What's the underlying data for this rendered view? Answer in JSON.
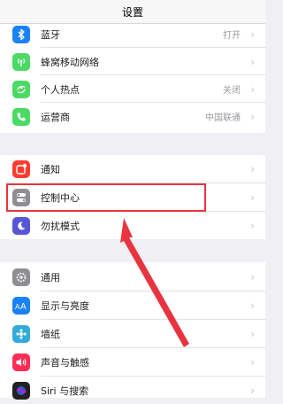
{
  "header": {
    "title": "设置"
  },
  "groups": [
    {
      "items": [
        {
          "label": "蓝牙",
          "detail": "打开",
          "icon": "bluetooth-icon",
          "color": "#1a82f5"
        },
        {
          "label": "蜂窝移动网络",
          "detail": "",
          "icon": "cellular-icon",
          "color": "#4cd964"
        },
        {
          "label": "个人热点",
          "detail": "关闭",
          "icon": "hotspot-icon",
          "color": "#4cd964"
        },
        {
          "label": "运营商",
          "detail": "中国联通",
          "icon": "phone-icon",
          "color": "#4cd964"
        }
      ]
    },
    {
      "items": [
        {
          "label": "通知",
          "detail": "",
          "icon": "notifications-icon",
          "color": "#ff3b30"
        },
        {
          "label": "控制中心",
          "detail": "",
          "icon": "control-center-icon",
          "color": "#8e8e93"
        },
        {
          "label": "勿扰模式",
          "detail": "",
          "icon": "moon-icon",
          "color": "#5856d6"
        }
      ]
    },
    {
      "items": [
        {
          "label": "通用",
          "detail": "",
          "icon": "gear-icon",
          "color": "#8e8e93"
        },
        {
          "label": "显示与亮度",
          "detail": "",
          "icon": "display-icon",
          "color": "#1a82f5"
        },
        {
          "label": "墙纸",
          "detail": "",
          "icon": "wallpaper-icon",
          "color": "#33aadc"
        },
        {
          "label": "声音与触感",
          "detail": "",
          "icon": "sound-icon",
          "color": "#ff2d55"
        },
        {
          "label": "Siri 与搜索",
          "detail": "",
          "icon": "siri-icon",
          "color": "#222222"
        }
      ]
    }
  ],
  "annotation": {
    "highlight_color": "#e8343f",
    "highlighted_item": "控制中心"
  }
}
